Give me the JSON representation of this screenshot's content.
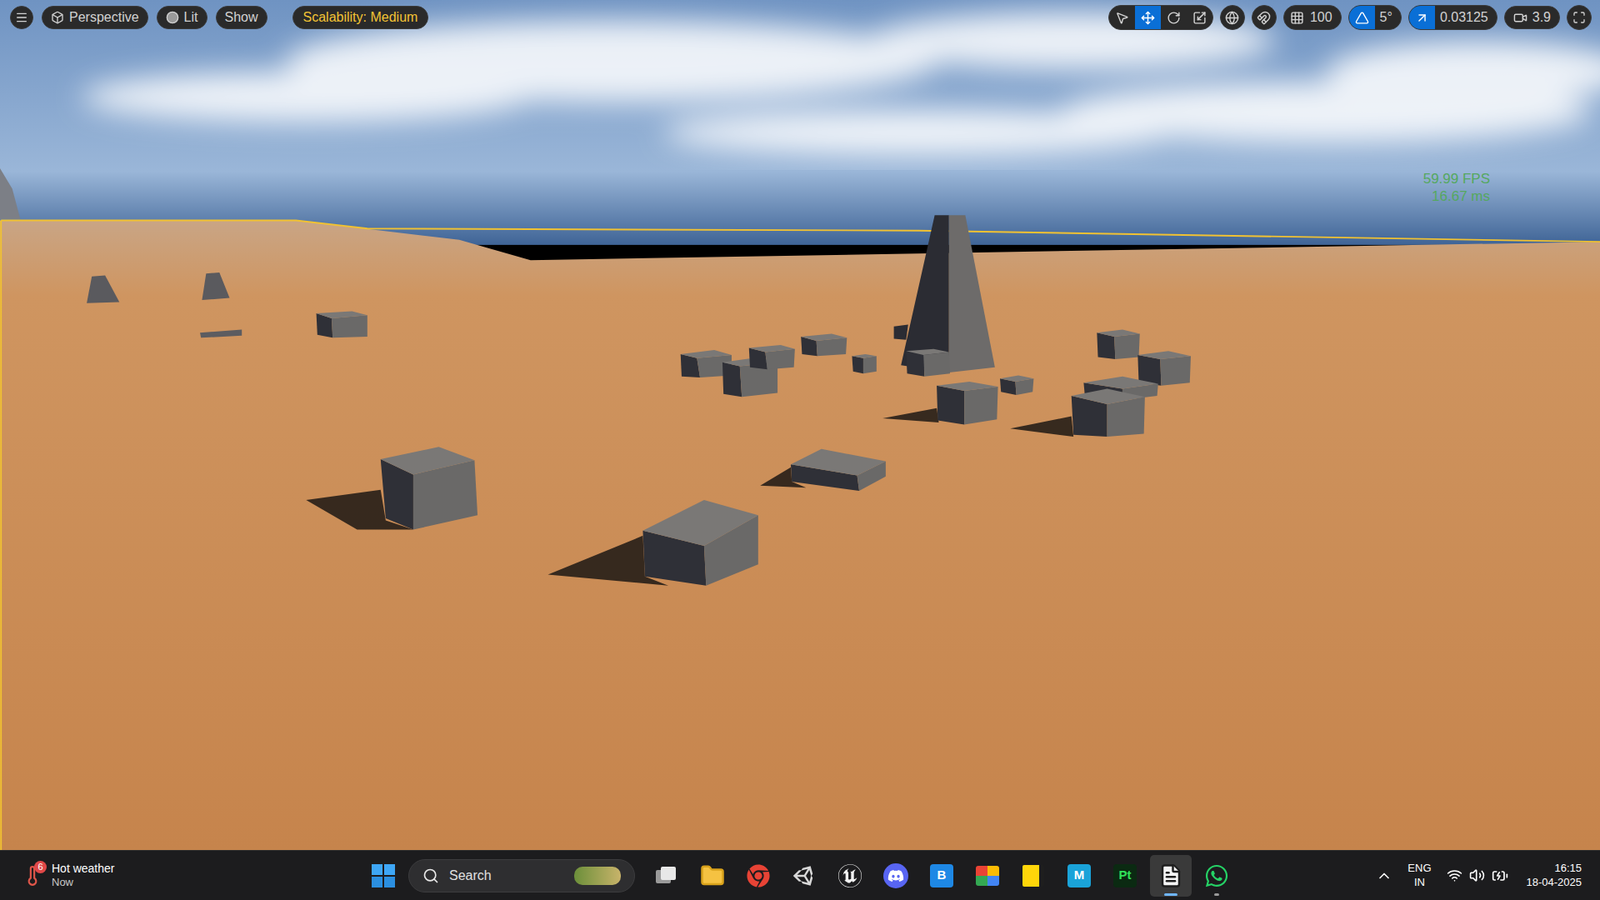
{
  "viewport": {
    "toolbar_left": [
      {
        "label": "Perspective",
        "kind": "view"
      },
      {
        "label": "Lit",
        "kind": "lit"
      },
      {
        "label": "Show",
        "kind": "show"
      }
    ],
    "scalability": "Scalability: Medium",
    "transform_tools": [
      {
        "tool": "select",
        "selected": false
      },
      {
        "tool": "translate",
        "selected": true
      },
      {
        "tool": "rotate",
        "selected": false
      },
      {
        "tool": "scale",
        "selected": false
      }
    ],
    "grid_snap": {
      "value": "100",
      "on": false
    },
    "rotation_snap": {
      "value": "5°",
      "on": true
    },
    "scale_snap": {
      "value": "0.03125",
      "on": true
    },
    "camera_speed": "3.9",
    "stats": [
      "59.99 FPS",
      "16.67 ms"
    ]
  },
  "taskbar": {
    "weather": {
      "title": "Hot weather",
      "subtitle": "Now",
      "badge": "6"
    },
    "search": {
      "placeholder": "Search"
    },
    "apps": [
      {
        "kind": "task-view",
        "running": false
      },
      {
        "kind": "explorer",
        "running": false
      },
      {
        "kind": "chrome",
        "running": false
      },
      {
        "kind": "unity",
        "running": false
      },
      {
        "kind": "unreal",
        "running": false
      },
      {
        "kind": "discord",
        "running": false
      },
      {
        "kind": "letter",
        "glyph": "B",
        "color": "#1e88e5",
        "running": false
      },
      {
        "kind": "meet",
        "running": false
      },
      {
        "kind": "sticky",
        "running": false
      },
      {
        "kind": "letter",
        "glyph": "M",
        "color": "#1aa3d9",
        "running": false
      },
      {
        "kind": "letter",
        "glyph": "Pt",
        "color": "#0b2a12",
        "running": false
      },
      {
        "kind": "notepad",
        "running": true
      },
      {
        "kind": "whatsapp",
        "running": true
      }
    ],
    "tray": {
      "language": "ENG",
      "region": "IN",
      "time": "16:15",
      "date": "18-04-2025"
    }
  }
}
